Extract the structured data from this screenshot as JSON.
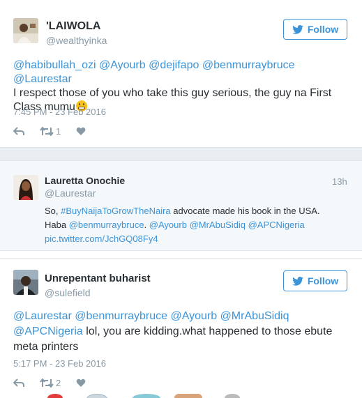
{
  "tweets": [
    {
      "name": "'LAIWOLA",
      "handle": "@wealthyinka",
      "follow_label": "Follow",
      "mentions": "@habibullah_ozi @Ayourb @dejifapo @benmurraybruce @Laurestar",
      "text": "I respect those of you who take this guy serious, the guy na First Class mumu",
      "timestamp": "7:45 PM - 23 Feb 2016",
      "retweets": "1",
      "likes": ""
    },
    {
      "name": "Lauretta Onochie",
      "handle": "@Laurestar",
      "time_ago": "13h",
      "text_prefix": "So, ",
      "hashtag": "#BuyNaijaToGrowTheNaira",
      "text_middle": " advocate made his book in the USA.",
      "line2_prefix": "Haba ",
      "mention1": "@benmurraybruce",
      "mention1_suffix": ". ",
      "mention2": "@Ayourb",
      "mention3": "@MrAbuSidiq",
      "mention4": "@APCNigeria",
      "pic_link": "pic.twitter.com/JchGQ08Fy4"
    },
    {
      "name": "Unrepentant buharist",
      "handle": "@sulefield",
      "follow_label": "Follow",
      "mentions_line1": "@Laurestar @benmurraybruce @Ayourb @MrAbuSidiq",
      "mention_line2": "@APCNigeria",
      "text": " lol, you are kidding.what happened to those ebute",
      "text_line3": "meta printers",
      "timestamp": "5:17 PM - 23 Feb 2016",
      "retweets": "2",
      "likes": ""
    }
  ],
  "colors": {
    "link": "#3b94d9",
    "muted": "#8899a6",
    "text": "#292f33",
    "emoji": "#f7c21e"
  }
}
